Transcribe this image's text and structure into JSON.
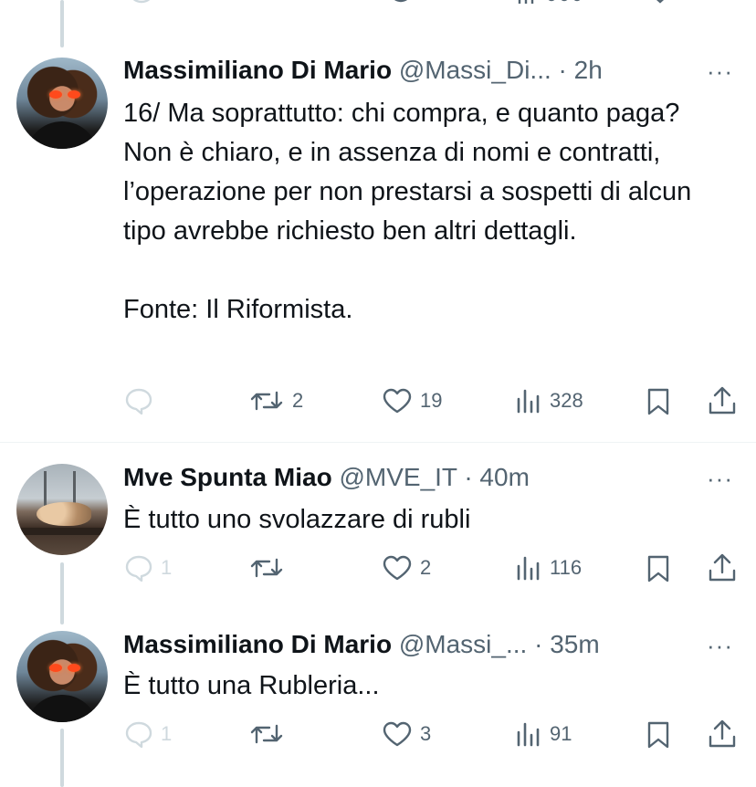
{
  "tweets": [
    {
      "name": "Massimiliano Di Mario",
      "handle": "@Massi_Di...",
      "time": "· 2h",
      "more": "···",
      "text": "16/ Ma soprattutto: chi compra, e quanto paga? Non è chiaro, e in assenza di nomi e contratti, l’operazione per non prestarsi a sospetti di alcun tipo avrebbe richiesto ben altri dettagli.\n\nFonte: Il Riformista.",
      "replies": "",
      "retweets": "2",
      "likes": "19",
      "views": "328"
    },
    {
      "name": "Mve Spunta Miao",
      "handle": "@MVE_IT",
      "time": "· 40m",
      "more": "···",
      "text": "È tutto uno svolazzare di rubli",
      "replies": "1",
      "retweets": "",
      "likes": "2",
      "views": "116"
    },
    {
      "name": "Massimiliano Di Mario",
      "handle": "@Massi_...",
      "time": "· 35m",
      "more": "···",
      "text": "È tutto una Rubleria...",
      "replies": "1",
      "retweets": "",
      "likes": "3",
      "views": "91"
    }
  ],
  "colors": {
    "text": "#0f1419",
    "secondary": "#536471",
    "thread_line": "#cfd9de",
    "divider": "#eff3f4",
    "background": "#ffffff"
  },
  "icons": [
    "reply-icon",
    "retweet-icon",
    "like-icon",
    "views-icon",
    "bookmark-icon",
    "share-icon",
    "more-icon"
  ]
}
